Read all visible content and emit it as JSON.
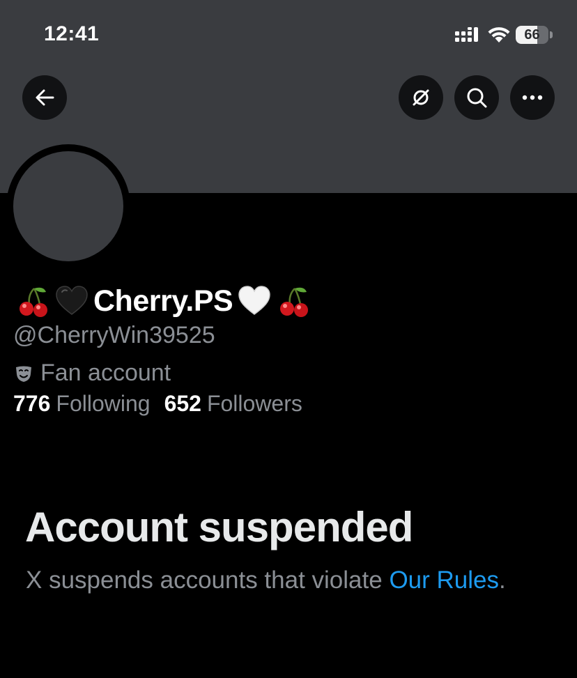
{
  "status_bar": {
    "time": "12:41",
    "battery_level": "66",
    "battery_fraction": 0.66
  },
  "header": {
    "back_icon": "arrow-left-icon",
    "grok_icon": "grok-icon",
    "search_icon": "search-icon",
    "more_icon": "more-horizontal-icon"
  },
  "profile": {
    "display_name": "Cherry.PS",
    "name_prefix_icons": [
      "cherries-emoji-icon",
      "black-heart-emoji-icon"
    ],
    "name_suffix_icons": [
      "white-heart-emoji-icon",
      "cherries-emoji-icon"
    ],
    "handle": "@CherryWin39525",
    "affiliation_icon": "performing-arts-mask-icon",
    "affiliation": "Fan account",
    "following_count": "776",
    "following_label": "Following",
    "followers_count": "652",
    "followers_label": "Followers"
  },
  "suspension": {
    "title": "Account suspended",
    "description": "X suspends accounts that violate ",
    "link_text": "Our Rules",
    "suffix": "."
  },
  "colors": {
    "banner": "#3a3c40",
    "background": "#000000",
    "link": "#1d9bf0",
    "secondary_text": "#8b8f95"
  }
}
